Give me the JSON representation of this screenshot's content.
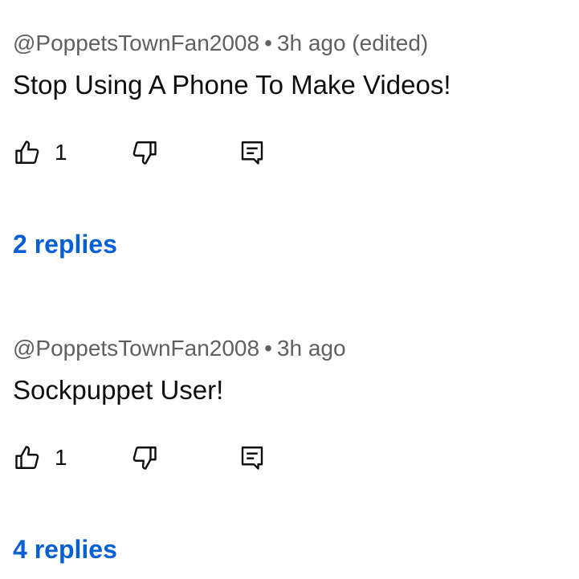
{
  "comments": [
    {
      "author": "@PoppetsTownFan2008",
      "separator": "•",
      "time": "3h ago (edited)",
      "text": "Stop Using A Phone To Make Videos!",
      "like_count": "1",
      "replies": "2 replies",
      "icons": [
        "thumbs-up-icon",
        "thumbs-down-icon",
        "reply-icon"
      ]
    },
    {
      "author": "@PoppetsTownFan2008",
      "separator": "•",
      "time": "3h ago",
      "text": "Sockpuppet User!",
      "like_count": "1",
      "replies": "4 replies",
      "icons": [
        "thumbs-up-icon",
        "thumbs-down-icon",
        "reply-icon"
      ]
    }
  ],
  "colors": {
    "meta": "#606060",
    "text": "#0f0f0f",
    "link": "#065fd4"
  }
}
